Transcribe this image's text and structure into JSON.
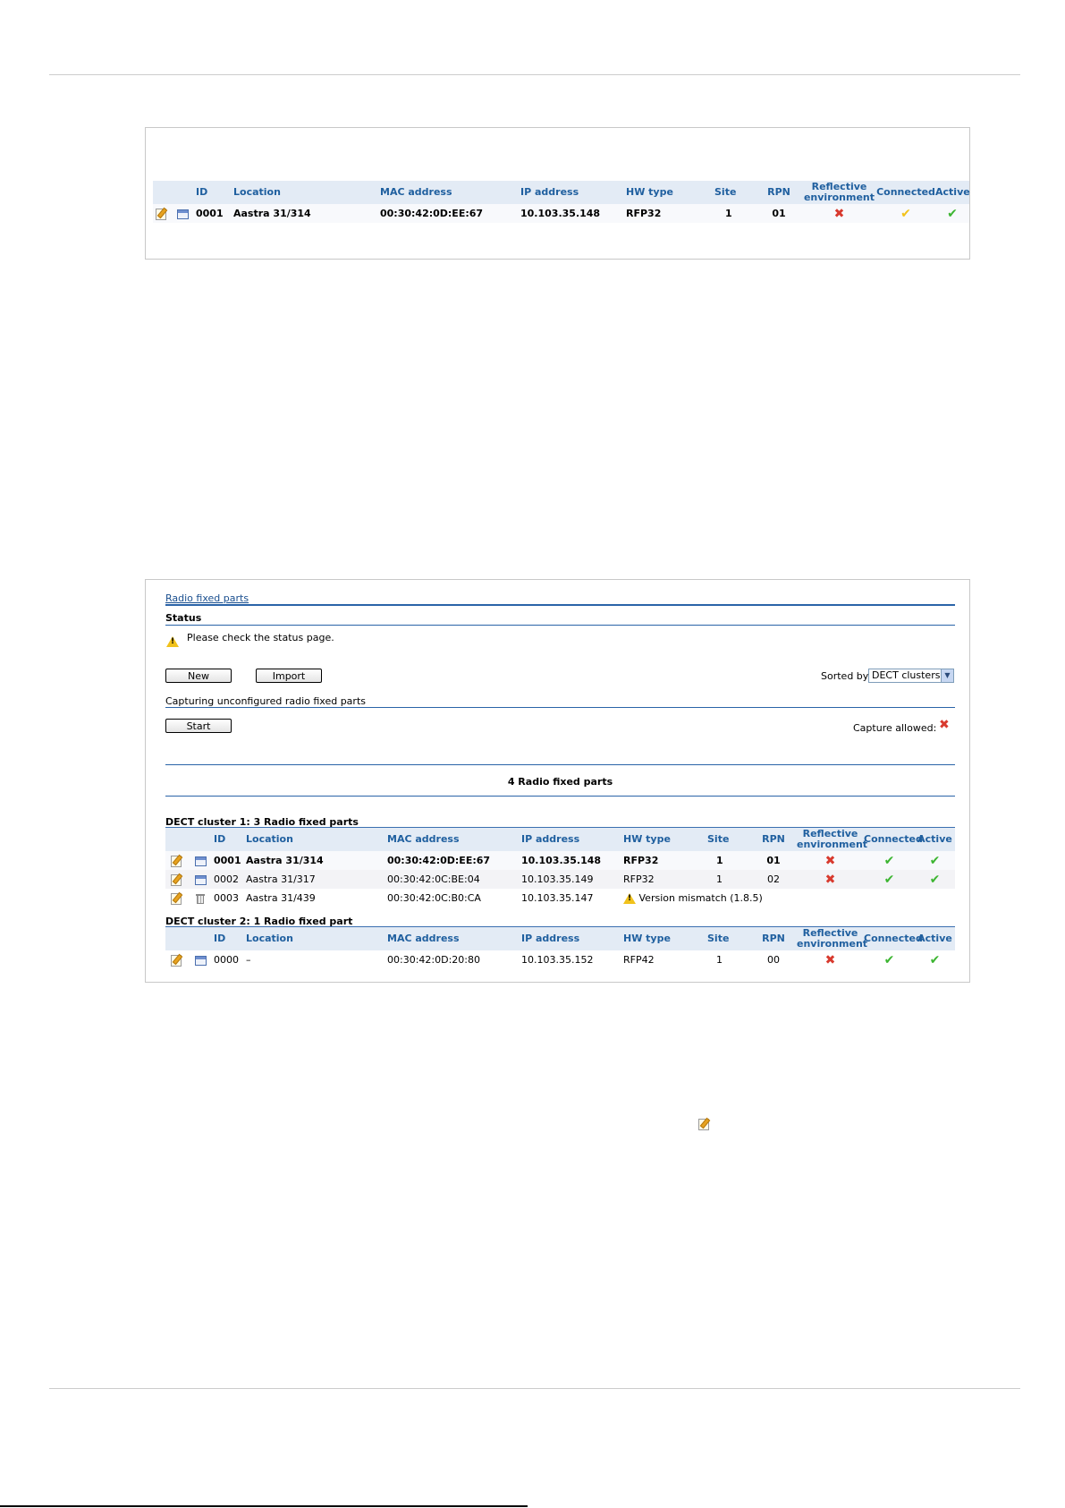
{
  "colors": {
    "accent": "#1f5f9f",
    "error": "#d83a2e",
    "ok": "#3cb531",
    "warning": "#f2c21a"
  },
  "panel1": {
    "columns": [
      "ID",
      "Location",
      "MAC address",
      "IP address",
      "HW type",
      "Site",
      "RPN",
      "Reflective environment",
      "Connected",
      "Active"
    ],
    "rows": [
      {
        "id": "0001",
        "location": "Aastra 31/314",
        "mac": "00:30:42:0D:EE:67",
        "ip": "10.103.35.148",
        "hw": "RFP32",
        "site": "1",
        "rpn": "01",
        "reflective": "x-icon",
        "connected": "check-yellow-icon",
        "active": "check-green-icon"
      }
    ]
  },
  "panel2": {
    "title": "Radio fixed parts",
    "status_label": "Status",
    "status_message": "Please check the status page.",
    "new_button": "New",
    "import_button": "Import",
    "sorted_by_label": "Sorted by",
    "sorted_by_value": "DECT clusters",
    "capture_title": "Capturing unconfigured radio fixed parts",
    "start_button": "Start",
    "capture_allowed_label": "Capture allowed:",
    "summary": "4 Radio fixed parts",
    "columns": [
      "ID",
      "Location",
      "MAC address",
      "IP address",
      "HW type",
      "Site",
      "RPN",
      "Reflective environment",
      "Connected",
      "Active"
    ],
    "clusters": [
      {
        "title": "DECT cluster 1: 3 Radio fixed parts",
        "rows": [
          {
            "id": "0001",
            "location": "Aastra 31/314",
            "mac": "00:30:42:0D:EE:67",
            "ip": "10.103.35.148",
            "hw": "RFP32",
            "site": "1",
            "rpn": "01"
          },
          {
            "id": "0002",
            "location": "Aastra 31/317",
            "mac": "00:30:42:0C:BE:04",
            "ip": "10.103.35.149",
            "hw": "RFP32",
            "site": "1",
            "rpn": "02"
          },
          {
            "id": "0003",
            "location": "Aastra 31/439",
            "mac": "00:30:42:0C:B0:CA",
            "ip": "10.103.35.147",
            "warning": "Version mismatch (1.8.5)"
          }
        ]
      },
      {
        "title": "DECT cluster 2: 1 Radio fixed part",
        "rows": [
          {
            "id": "0000",
            "location": "–",
            "mac": "00:30:42:0D:20:80",
            "ip": "10.103.35.152",
            "hw": "RFP42",
            "site": "1",
            "rpn": "00"
          }
        ]
      }
    ]
  }
}
